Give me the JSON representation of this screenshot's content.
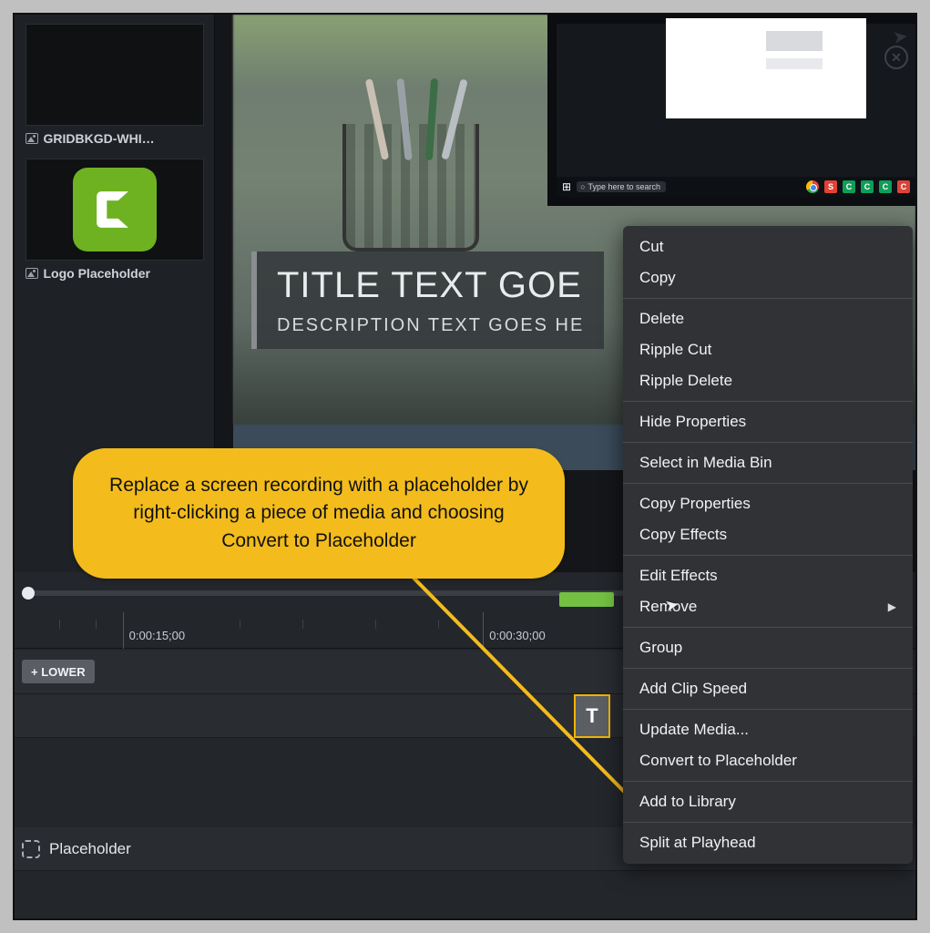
{
  "mediabin": {
    "items": [
      {
        "name": "GRIDBKGD-WHI…"
      },
      {
        "name": "Logo Placeholder"
      }
    ]
  },
  "canvas": {
    "title": "TITLE TEXT GOE",
    "subtitle": "DESCRIPTION TEXT GOES HE",
    "taskbar_search_placeholder": "Type here to search"
  },
  "timeline": {
    "ticks": [
      "0:00:15;00",
      "0:00:30;00"
    ],
    "track1_label": "+  LOWER",
    "track3_label": "Placeholder"
  },
  "context_menu": {
    "items": [
      "Cut",
      "Copy",
      "---",
      "Delete",
      "Ripple Cut",
      "Ripple Delete",
      "---",
      "Hide Properties",
      "---",
      "Select in Media Bin",
      "---",
      "Copy Properties",
      "Copy Effects",
      "---",
      "Edit Effects",
      "Remove",
      "---",
      "Group",
      "---",
      "Add Clip Speed",
      "---",
      "Update Media...",
      "Convert to Placeholder",
      "---",
      "Add to Library",
      "---",
      "Split at Playhead"
    ],
    "submenu_items": [
      "Remove"
    ]
  },
  "callout": {
    "text": "Replace a screen recording with a placeholder by right-clicking a piece of media and choosing Convert to Placeholder"
  }
}
